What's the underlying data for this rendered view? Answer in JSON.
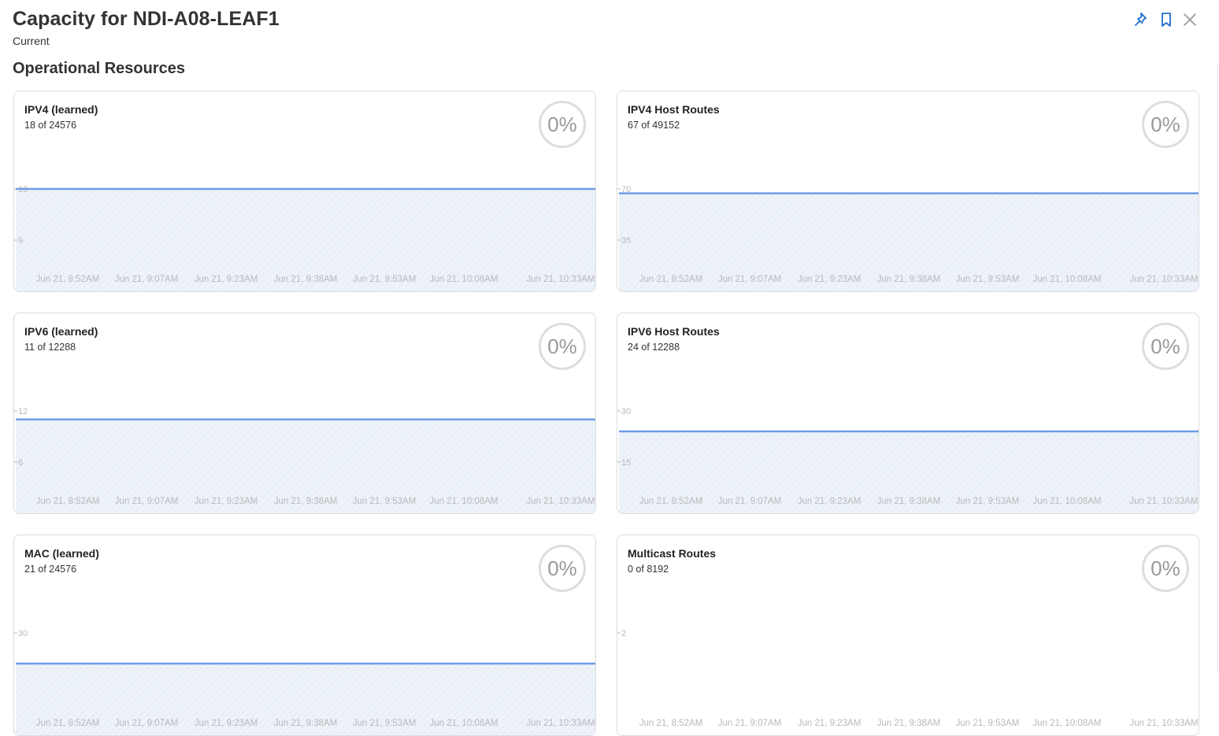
{
  "header": {
    "title": "Capacity for NDI-A08-LEAF1",
    "subtitle": "Current",
    "actions": [
      {
        "icon": "pin-icon",
        "color": "#1f6cc9"
      },
      {
        "icon": "bookmark-icon",
        "color": "#1f6cc9"
      },
      {
        "icon": "close-icon",
        "color": "#999999"
      }
    ]
  },
  "section": {
    "title": "Operational Resources"
  },
  "colors": {
    "series_line": "#6e9ce6",
    "area_fill": "#eef3fa",
    "axis_text": "#b8b8b8"
  },
  "cards": [
    {
      "name": "IPV4 (learned)",
      "usage": "18 of 24576",
      "percent": "0%",
      "chart_data": {
        "type": "area",
        "x": [
          "Jun 21, 8:52AM",
          "Jun 21, 9:07AM",
          "Jun 21, 9:23AM",
          "Jun 21, 9:38AM",
          "Jun 21, 9:53AM",
          "Jun 21, 10:08AM",
          "Jun 21, 10:33AM"
        ],
        "values": [
          18,
          18,
          18,
          18,
          18,
          18,
          18
        ],
        "yticks": [
          "18",
          "9"
        ],
        "ylim": [
          0,
          18
        ],
        "xlabel": "",
        "ylabel": ""
      }
    },
    {
      "name": "IPV4 Host Routes",
      "usage": "67 of 49152",
      "percent": "0%",
      "chart_data": {
        "type": "area",
        "x": [
          "Jun 21, 8:52AM",
          "Jun 21, 9:07AM",
          "Jun 21, 9:23AM",
          "Jun 21, 9:38AM",
          "Jun 21, 9:53AM",
          "Jun 21, 10:08AM",
          "Jun 21, 10:33AM"
        ],
        "values": [
          67,
          67,
          67,
          67,
          67,
          67,
          67
        ],
        "yticks": [
          "70",
          "35"
        ],
        "ylim": [
          0,
          70
        ],
        "xlabel": "",
        "ylabel": ""
      }
    },
    {
      "name": "IPV6 (learned)",
      "usage": "11 of 12288",
      "percent": "0%",
      "chart_data": {
        "type": "area",
        "x": [
          "Jun 21, 8:52AM",
          "Jun 21, 9:07AM",
          "Jun 21, 9:23AM",
          "Jun 21, 9:38AM",
          "Jun 21, 9:53AM",
          "Jun 21, 10:08AM",
          "Jun 21, 10:33AM"
        ],
        "values": [
          11,
          11,
          11,
          11,
          11,
          11,
          11
        ],
        "yticks": [
          "12",
          "6"
        ],
        "ylim": [
          0,
          12
        ],
        "xlabel": "",
        "ylabel": ""
      }
    },
    {
      "name": "IPV6 Host Routes",
      "usage": "24 of 12288",
      "percent": "0%",
      "chart_data": {
        "type": "area",
        "x": [
          "Jun 21, 8:52AM",
          "Jun 21, 9:07AM",
          "Jun 21, 9:23AM",
          "Jun 21, 9:38AM",
          "Jun 21, 9:53AM",
          "Jun 21, 10:08AM",
          "Jun 21, 10:33AM"
        ],
        "values": [
          24,
          24,
          24,
          24,
          24,
          24,
          24
        ],
        "yticks": [
          "30",
          "15"
        ],
        "ylim": [
          0,
          30
        ],
        "xlabel": "",
        "ylabel": ""
      }
    },
    {
      "name": "MAC (learned)",
      "usage": "21 of 24576",
      "percent": "0%",
      "chart_data": {
        "type": "area",
        "x": [
          "Jun 21, 8:52AM",
          "Jun 21, 9:07AM",
          "Jun 21, 9:23AM",
          "Jun 21, 9:38AM",
          "Jun 21, 9:53AM",
          "Jun 21, 10:08AM",
          "Jun 21, 10:33AM"
        ],
        "values": [
          21,
          21,
          21,
          21,
          21,
          21,
          21
        ],
        "yticks": [
          "30"
        ],
        "ylim": [
          0,
          30
        ],
        "xlabel": "",
        "ylabel": ""
      }
    },
    {
      "name": "Multicast Routes",
      "usage": "0 of 8192",
      "percent": "0%",
      "chart_data": {
        "type": "area",
        "x": [
          "Jun 21, 8:52AM",
          "Jun 21, 9:07AM",
          "Jun 21, 9:23AM",
          "Jun 21, 9:38AM",
          "Jun 21, 9:53AM",
          "Jun 21, 10:08AM",
          "Jun 21, 10:33AM"
        ],
        "values": [],
        "yticks": [
          "2"
        ],
        "ylim": [
          0,
          2
        ],
        "xlabel": "",
        "ylabel": ""
      }
    }
  ]
}
